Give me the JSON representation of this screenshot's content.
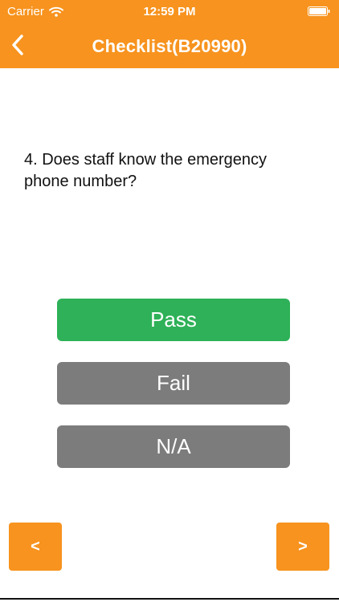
{
  "status_bar": {
    "carrier": "Carrier",
    "time": "12:59 PM",
    "wifi_icon": "wifi-icon",
    "battery_icon": "battery-icon"
  },
  "nav": {
    "back_icon": "chevron-left-icon",
    "title": "Checklist(B20990)"
  },
  "question": {
    "text": "4. Does staff know the emergency phone number?"
  },
  "answers": {
    "pass": "Pass",
    "fail": "Fail",
    "na": "N/A"
  },
  "navigation": {
    "prev": "<",
    "next": ">"
  },
  "colors": {
    "accent": "#f7931e",
    "pass": "#2eb158",
    "neutral": "#7c7c7c",
    "text": "#111111"
  }
}
